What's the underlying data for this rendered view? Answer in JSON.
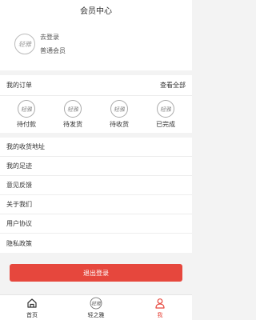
{
  "header": {
    "title": "会员中心"
  },
  "profile": {
    "login_label": "去登录",
    "level_label": "普通会员",
    "avatar_icon": "brand-logo-icon"
  },
  "orders": {
    "title": "我的订单",
    "view_all": "查看全部",
    "tabs": [
      {
        "label": "待付款",
        "icon": "brand-logo-icon"
      },
      {
        "label": "待发货",
        "icon": "brand-logo-icon"
      },
      {
        "label": "待收货",
        "icon": "brand-logo-icon"
      },
      {
        "label": "已完成",
        "icon": "brand-logo-icon"
      }
    ]
  },
  "menu": {
    "items": [
      {
        "label": "我的收货地址"
      },
      {
        "label": "我的足迹"
      },
      {
        "label": "意见反馈"
      },
      {
        "label": "关于我们"
      },
      {
        "label": "用户协议"
      },
      {
        "label": "隐私政策"
      }
    ]
  },
  "logout": {
    "label": "退出登录"
  },
  "tabbar": {
    "items": [
      {
        "label": "首页",
        "icon": "home-icon",
        "active": false
      },
      {
        "label": "轻之雅",
        "icon": "brand-logo-icon",
        "active": false
      },
      {
        "label": "我",
        "icon": "person-icon",
        "active": true
      }
    ]
  },
  "colors": {
    "accent": "#e6473d",
    "background": "#f3f3f3"
  }
}
